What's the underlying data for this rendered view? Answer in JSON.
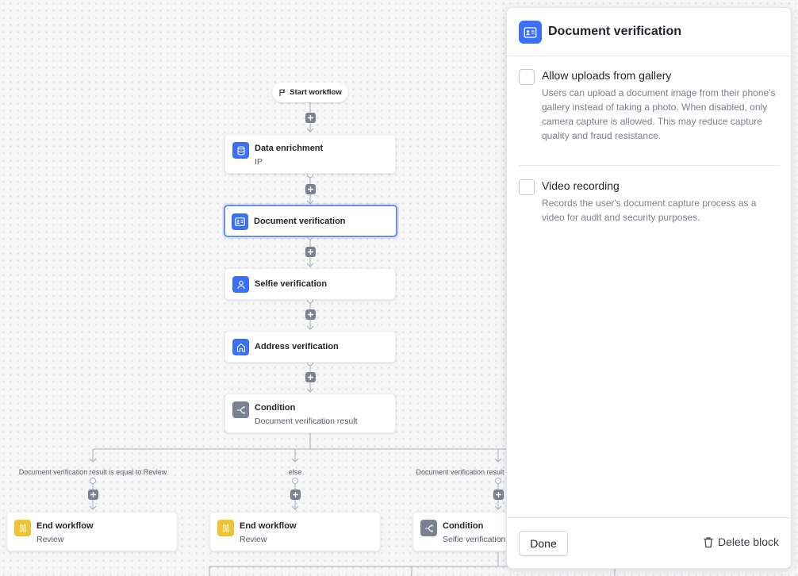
{
  "workflow": {
    "start_label": "Start workflow",
    "nodes": [
      {
        "title": "Data enrichment",
        "subtitle": "IP",
        "icon": "database-icon"
      },
      {
        "title": "Document verification",
        "subtitle": "",
        "icon": "id-card-icon",
        "selected": true
      },
      {
        "title": "Selfie verification",
        "subtitle": "",
        "icon": "user-icon"
      },
      {
        "title": "Address verification",
        "subtitle": "",
        "icon": "home-icon"
      },
      {
        "title": "Condition",
        "subtitle": "Document verification result",
        "icon": "branch-icon"
      }
    ],
    "branches": [
      {
        "label": "Document verification result is equal to Review",
        "node_title": "End workflow",
        "node_subtitle": "Review",
        "icon": "pause-icon"
      },
      {
        "label": "else",
        "node_title": "End workflow",
        "node_subtitle": "Review",
        "icon": "pause-icon"
      },
      {
        "label": "Document verification result",
        "node_title": "Condition",
        "node_subtitle": "Selfie verification",
        "icon": "branch-icon"
      }
    ]
  },
  "panel": {
    "title": "Document verification",
    "options": [
      {
        "title": "Allow uploads from gallery",
        "description": "Users can upload a document image from their phone's gallery instead of taking a photo. When disabled, only camera capture is allowed. This may reduce capture quality and fraud resistance.",
        "checked": false
      },
      {
        "title": "Video recording",
        "description": "Records the user's document capture process as a video for audit and security purposes.",
        "checked": false
      }
    ],
    "done_label": "Done",
    "delete_label": "Delete block"
  },
  "colors": {
    "accent": "#3b6ff5",
    "condition": "#7b8192",
    "end": "#f2c230",
    "selected_border": "#6b8ef2"
  }
}
